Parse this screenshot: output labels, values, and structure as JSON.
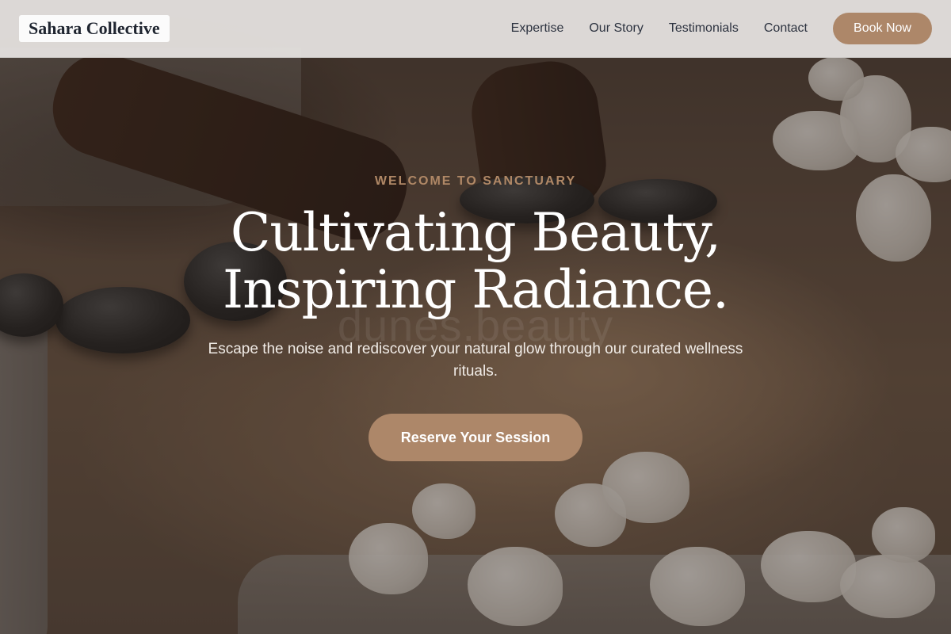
{
  "nav": {
    "brand": "Sahara Collective",
    "links": [
      "Expertise",
      "Our Story",
      "Testimonials",
      "Contact"
    ],
    "book_label": "Book Now"
  },
  "hero": {
    "eyebrow": "WELCOME TO SANCTUARY",
    "headline_line1": "Cultivating Beauty,",
    "headline_line2": "Inspiring Radiance.",
    "watermark": "dunes.beauty",
    "subtext": "Escape the noise and rediscover your natural glow through our curated wellness rituals.",
    "cta_label": "Reserve Your Session"
  },
  "colors": {
    "accent": "#ad8769",
    "eyebrow": "#b08866",
    "nav_bg": "#e8e5e3",
    "text_dark": "#2d3340"
  }
}
